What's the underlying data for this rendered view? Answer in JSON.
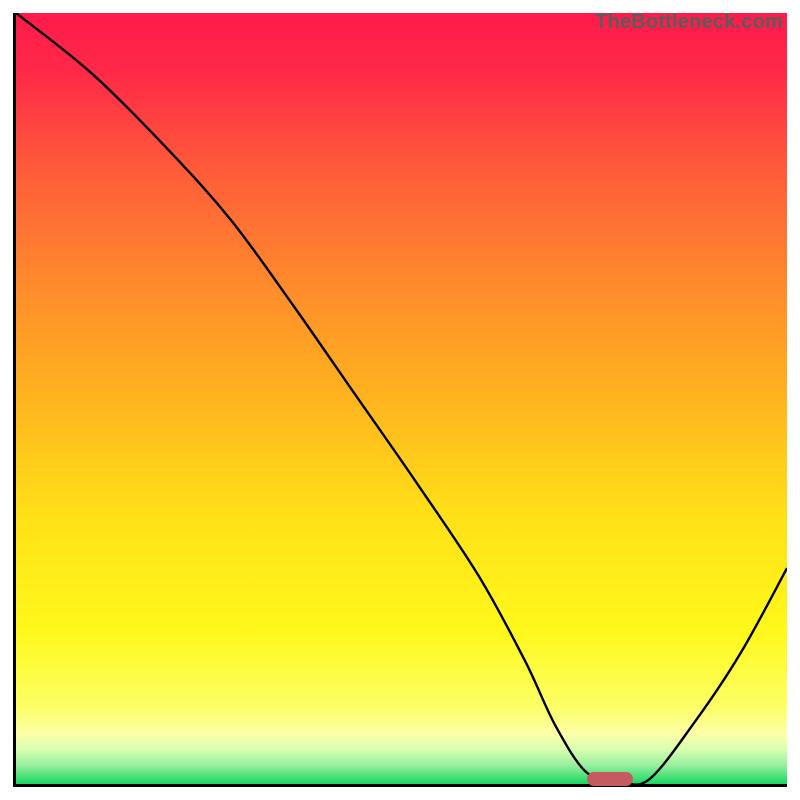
{
  "watermark": "TheBottleneck.com",
  "colors": {
    "axis": "#000000",
    "curve": "#000000",
    "marker": "#c65a61",
    "gradient_stops": [
      {
        "offset": 0.0,
        "color": "#ff1a4b"
      },
      {
        "offset": 0.08,
        "color": "#ff2a47"
      },
      {
        "offset": 0.2,
        "color": "#ff5a3a"
      },
      {
        "offset": 0.35,
        "color": "#ff8a2c"
      },
      {
        "offset": 0.5,
        "color": "#ffb41e"
      },
      {
        "offset": 0.65,
        "color": "#ffe018"
      },
      {
        "offset": 0.8,
        "color": "#fff81a"
      },
      {
        "offset": 0.9,
        "color": "#fcff66"
      },
      {
        "offset": 0.935,
        "color": "#fcffa8"
      },
      {
        "offset": 0.955,
        "color": "#d8ffb0"
      },
      {
        "offset": 0.975,
        "color": "#9af0a0"
      },
      {
        "offset": 1.0,
        "color": "#18d760"
      }
    ]
  },
  "chart_data": {
    "type": "line",
    "title": "",
    "xlabel": "",
    "ylabel": "",
    "xlim": [
      0,
      100
    ],
    "ylim": [
      0,
      100
    ],
    "grid": false,
    "x": [
      0,
      10,
      20,
      28,
      36,
      44,
      52,
      60,
      66,
      70,
      74,
      78,
      82,
      88,
      94,
      100
    ],
    "y": [
      100,
      92,
      82,
      73,
      62,
      50.5,
      39,
      27,
      16,
      7.5,
      1.5,
      0.5,
      0.5,
      8,
      17,
      28
    ],
    "marker": {
      "x": 77,
      "y": 0.6
    },
    "legend": false
  }
}
